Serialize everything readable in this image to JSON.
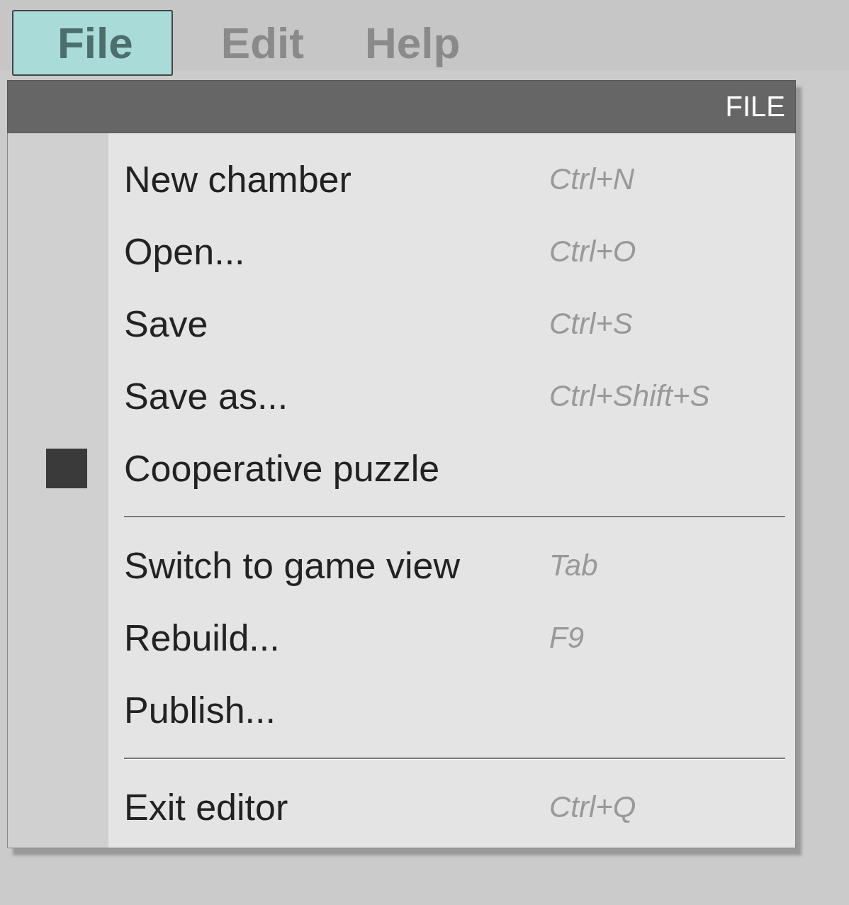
{
  "menubar": [
    {
      "label": "File",
      "selected": true
    },
    {
      "label": "Edit",
      "selected": false
    },
    {
      "label": "Help",
      "selected": false
    }
  ],
  "menu": {
    "title": "FILE",
    "sections": [
      [
        {
          "kind": "action",
          "label": "New chamber",
          "shortcut": "Ctrl+N"
        },
        {
          "kind": "action",
          "label": "Open...",
          "shortcut": "Ctrl+O"
        },
        {
          "kind": "action",
          "label": "Save",
          "shortcut": "Ctrl+S"
        },
        {
          "kind": "action",
          "label": "Save as...",
          "shortcut": "Ctrl+Shift+S"
        },
        {
          "kind": "toggle",
          "label": "Cooperative puzzle",
          "checked": true
        }
      ],
      [
        {
          "kind": "action",
          "label": "Switch to game view",
          "shortcut": "Tab"
        },
        {
          "kind": "action",
          "label": "Rebuild...",
          "shortcut": "F9"
        },
        {
          "kind": "action",
          "label": "Publish..."
        }
      ],
      [
        {
          "kind": "action",
          "label": "Exit editor",
          "shortcut": "Ctrl+Q"
        }
      ]
    ]
  }
}
